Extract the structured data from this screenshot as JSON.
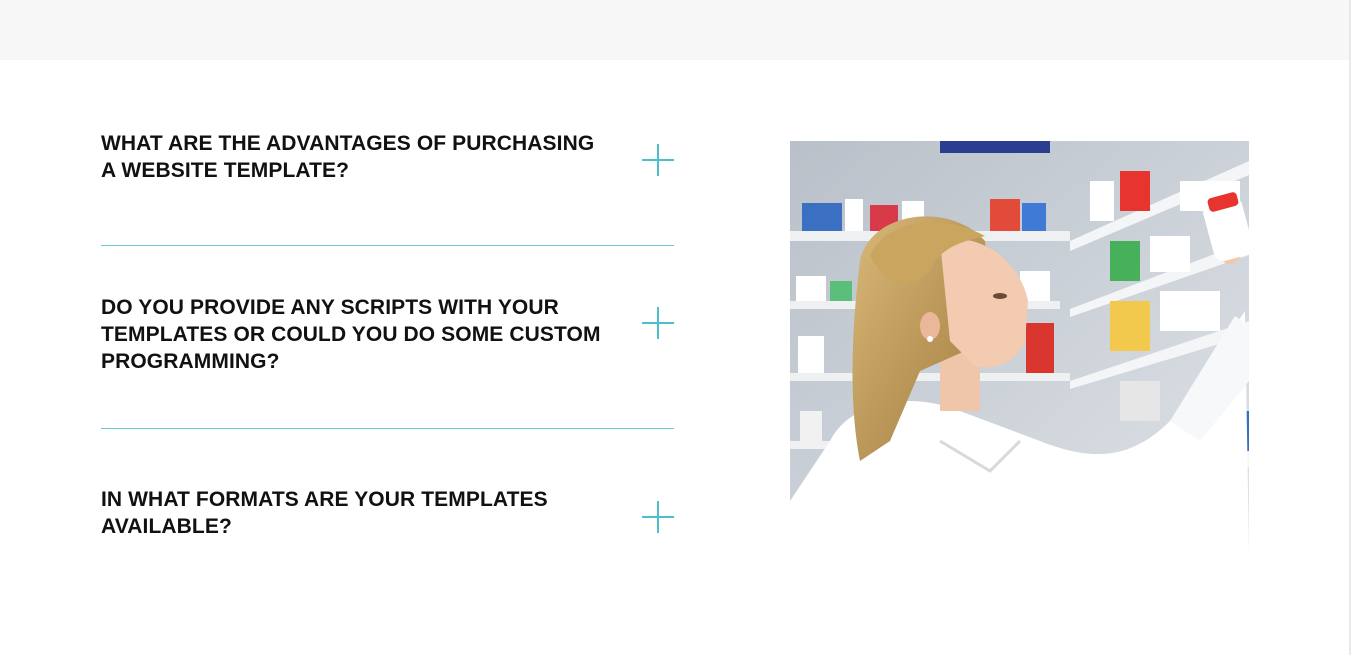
{
  "faq": {
    "items": [
      {
        "question": "WHAT ARE THE ADVANTAGES OF PURCHASING A WEBSITE TEMPLATE?",
        "icon": "plus-icon"
      },
      {
        "question": "DO YOU PROVIDE ANY SCRIPTS WITH YOUR TEMPLATES OR COULD YOU DO SOME CUSTOM PROGRAMMING?",
        "icon": "plus-icon"
      },
      {
        "question": "IN WHAT FORMATS ARE YOUR TEMPLATES AVAILABLE?",
        "icon": "plus-icon"
      }
    ]
  },
  "image": {
    "subject": "pharmacist-reaching-for-medicine-on-shelf"
  },
  "colors": {
    "accent": "#4dbfca",
    "divider": "#6fc6cf",
    "text": "#111111",
    "top_band": "#f7f7f7"
  }
}
